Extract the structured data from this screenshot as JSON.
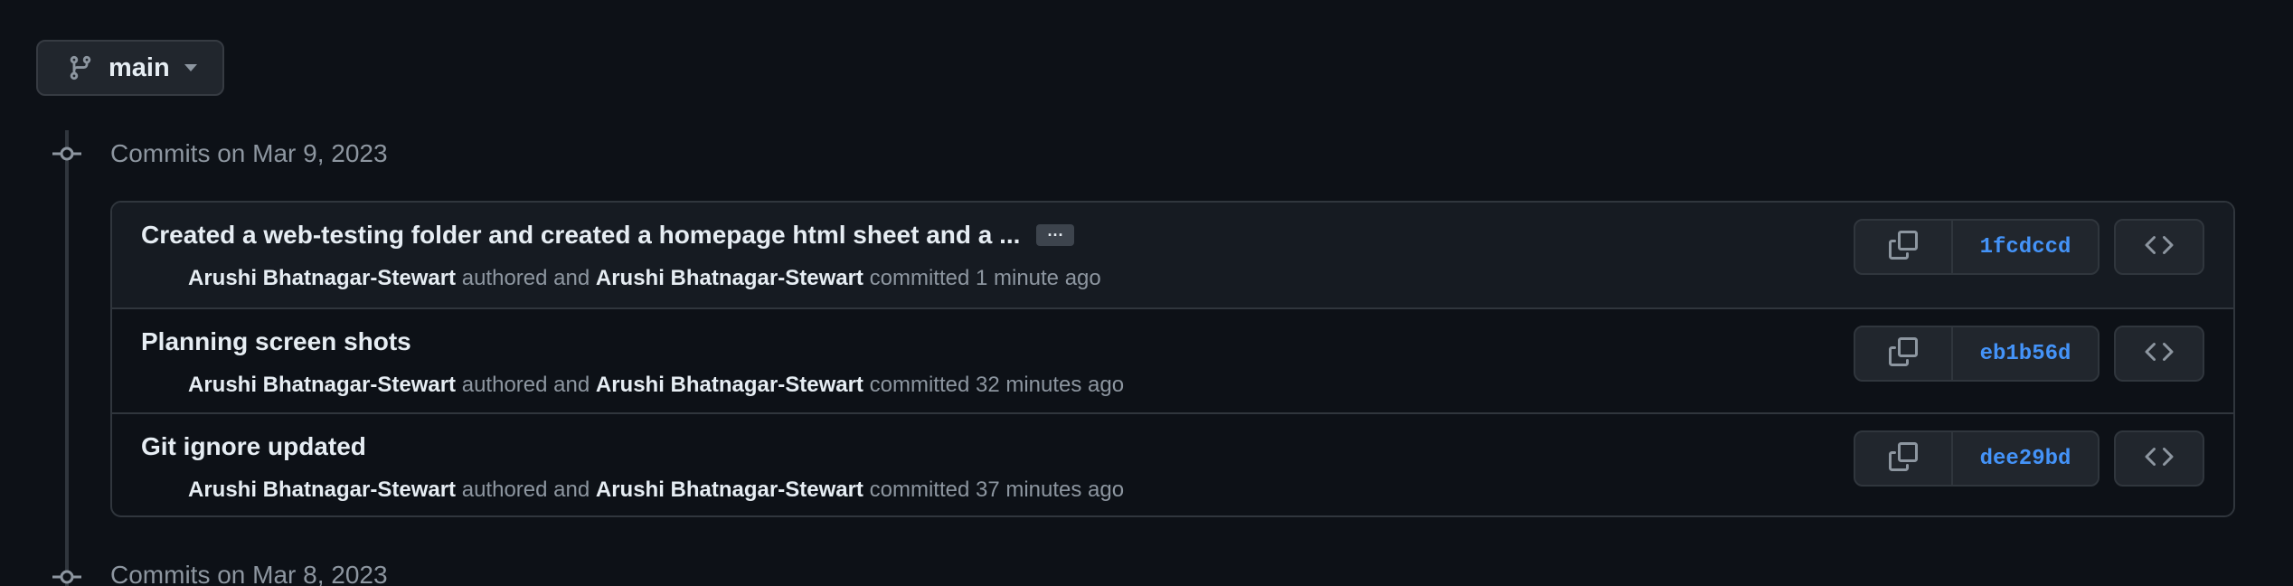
{
  "branch": {
    "name": "main",
    "icon": "git-branch-icon",
    "caret_icon": "triangle-down-icon"
  },
  "groups": [
    {
      "heading": "Commits on Mar 9, 2023",
      "commits": [
        {
          "title": "Created a web-testing folder and created a homepage html sheet and a ...",
          "has_ellipsis": true,
          "ellipsis_label": "···",
          "author": "Arushi Bhatnagar-Stewart",
          "authored_text": "authored and",
          "committer": "Arushi Bhatnagar-Stewart",
          "committed_text": "committed 1 minute ago",
          "sha": "1fcdccd"
        },
        {
          "title": "Planning screen shots",
          "has_ellipsis": false,
          "author": "Arushi Bhatnagar-Stewart",
          "authored_text": "authored and",
          "committer": "Arushi Bhatnagar-Stewart",
          "committed_text": "committed 32 minutes ago",
          "sha": "eb1b56d"
        },
        {
          "title": "Git ignore updated",
          "has_ellipsis": false,
          "author": "Arushi Bhatnagar-Stewart",
          "authored_text": "authored and",
          "committer": "Arushi Bhatnagar-Stewart",
          "committed_text": "committed 37 minutes ago",
          "sha": "dee29bd"
        }
      ]
    },
    {
      "heading": "Commits on Mar 8, 2023",
      "commits": []
    }
  ],
  "icons": {
    "copy": "copy-icon",
    "browse": "code-icon",
    "timeline_node": "commit-node-icon"
  },
  "colors": {
    "background": "#0d1117",
    "row_highlight": "#161b22",
    "border": "#30363d",
    "button_bg": "#21262d",
    "text_primary": "#e6edf3",
    "text_muted": "#8d96a0",
    "link": "#4493f8"
  }
}
